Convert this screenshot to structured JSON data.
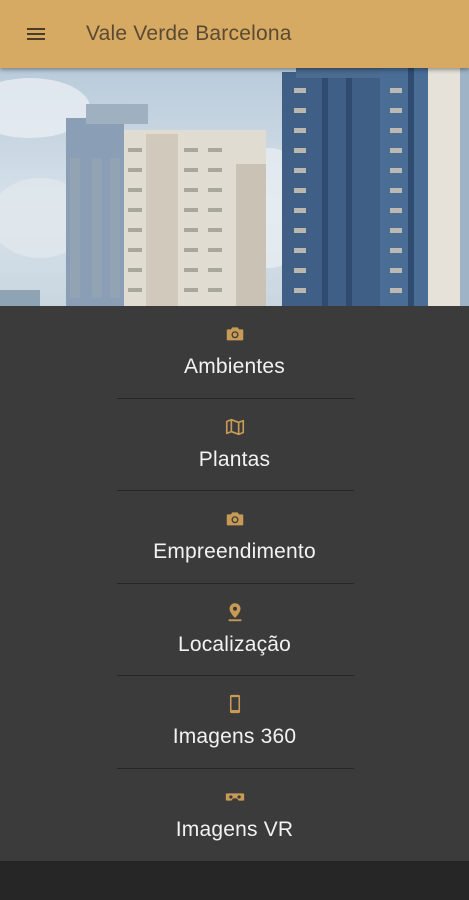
{
  "app_bar": {
    "title": "Vale Verde Barcelona",
    "menu_icon": "hamburger-menu-icon",
    "background": "#d6aa62"
  },
  "hero": {
    "image": "building-photo"
  },
  "menu": {
    "accent_color": "#c79b55",
    "items": [
      {
        "label": "Ambientes",
        "icon": "camera-icon"
      },
      {
        "label": "Plantas",
        "icon": "map-icon"
      },
      {
        "label": "Empreendimento",
        "icon": "camera-icon"
      },
      {
        "label": "Localização",
        "icon": "location-pin-icon"
      },
      {
        "label": "Imagens 360",
        "icon": "smartphone-icon"
      },
      {
        "label": "Imagens VR",
        "icon": "vr-headset-icon"
      }
    ]
  }
}
